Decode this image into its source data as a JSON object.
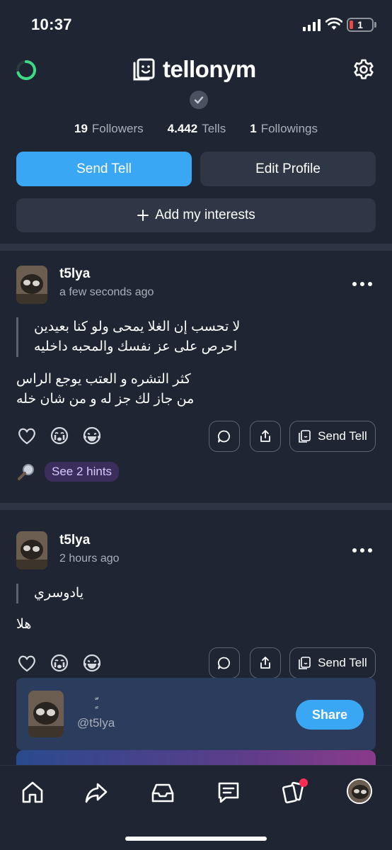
{
  "status_bar": {
    "time": "10:37",
    "battery_level": "1"
  },
  "header": {
    "brand": "tellonym"
  },
  "stats": [
    {
      "value": "19",
      "label": "Followers"
    },
    {
      "value": "4.442",
      "label": "Tells"
    },
    {
      "value": "1",
      "label": "Followings"
    }
  ],
  "buttons": {
    "send_tell": "Send Tell",
    "edit_profile": "Edit Profile",
    "add_interests": "Add my interests"
  },
  "posts": [
    {
      "username": "t5lya",
      "time": "a few seconds ago",
      "question_lines": [
        "لا تحسب إن الغلا يمحى ولو كنا بعيدين",
        "احرص على عز نفسك والمحبه داخليه"
      ],
      "answer_lines": [
        "كثر التشره و العتب يوجع الراس",
        "من جاز لك جز له و من شان خله"
      ],
      "send_tell_label": "Send Tell",
      "hints_label": "See 2 hints"
    },
    {
      "username": "t5lya",
      "time": "2 hours ago",
      "question_lines": [
        "يادوسري"
      ],
      "answer_lines": [
        "هلا"
      ],
      "send_tell_label": "Send Tell"
    }
  ],
  "share_card": {
    "mark": "ٍّ",
    "handle": "@t5lya",
    "share_label": "Share"
  },
  "colors": {
    "background": "#1f2532",
    "accent": "#3aa7f5",
    "button_secondary": "#2f3747",
    "hint_pill": "#3b2e5c",
    "notification_badge": "#ff2d55"
  },
  "tabbar": {
    "icons": [
      "home-icon",
      "share-arrow-icon",
      "inbox-tray-icon",
      "chat-icon",
      "cards-icon",
      "profile-avatar"
    ],
    "cards_has_badge": true
  }
}
